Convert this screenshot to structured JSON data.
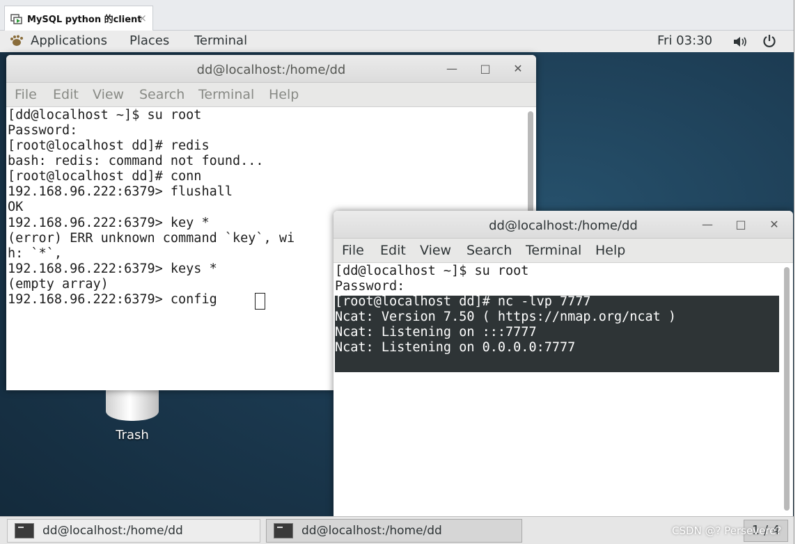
{
  "vm_tab": {
    "title": "MySQL python 的client",
    "close": "×"
  },
  "panel": {
    "applications": "Applications",
    "places": "Places",
    "terminal": "Terminal",
    "clock": "Fri 03:30",
    "volume_icon": "speaker-icon",
    "power_icon": "power-icon"
  },
  "window1": {
    "title": "dd@localhost:/home/dd",
    "menu": [
      "File",
      "Edit",
      "View",
      "Search",
      "Terminal",
      "Help"
    ],
    "lines": [
      "[dd@localhost ~]$ su root",
      "Password:",
      "[root@localhost dd]# redis",
      "bash: redis: command not found...",
      "[root@localhost dd]# conn",
      "192.168.96.222:6379> flushall",
      "OK",
      "192.168.96.222:6379> key *",
      "(error) ERR unknown command `key`, wi",
      "h: `*`,",
      "192.168.96.222:6379> keys *",
      "(empty array)",
      "192.168.96.222:6379> config "
    ]
  },
  "window2": {
    "title": "dd@localhost:/home/dd",
    "menu": [
      "File",
      "Edit",
      "View",
      "Search",
      "Terminal",
      "Help"
    ],
    "lines": [
      "[dd@localhost ~]$ su root",
      "Password:",
      "[root@localhost dd]# nc -lvp 7777",
      "Ncat: Version 7.50 ( https://nmap.org/ncat )",
      "Ncat: Listening on :::7777",
      "Ncat: Listening on 0.0.0.0:7777"
    ]
  },
  "desktop": {
    "trash_label": "Trash"
  },
  "taskbar": {
    "tasks": [
      "dd@localhost:/home/dd",
      "dd@localhost:/home/dd"
    ],
    "workspace": "1 / 4"
  },
  "watermark": "CSDN @? Persevere?",
  "colors": {
    "selection": "#2e3436",
    "panel": "#ececec",
    "desktop": "#1c3b52"
  }
}
